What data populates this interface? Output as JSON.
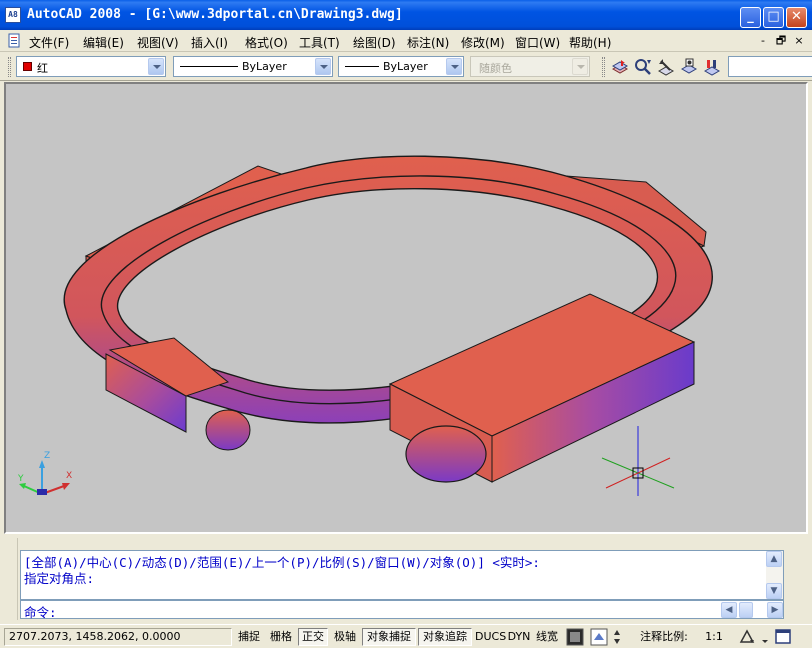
{
  "window": {
    "title": "AutoCAD 2008 - [G:\\www.3dportal.cn\\Drawing3.dwg]",
    "app_icon_text": "A8",
    "minimize": "_",
    "maximize": "□",
    "close": "✕"
  },
  "menu": {
    "items": [
      "文件(F)",
      "编辑(E)",
      "视图(V)",
      "插入(I)",
      "格式(O)",
      "工具(T)",
      "绘图(D)",
      "标注(N)",
      "修改(M)",
      "窗口(W)",
      "帮助(H)"
    ],
    "mdi": [
      "-",
      "🗗",
      "×"
    ]
  },
  "properties": {
    "color_value": "红",
    "color_swatch": "#E00000",
    "linetype_value": "ByLayer",
    "lineweight_value": "ByLayer",
    "plotstyle_value": "随颜色"
  },
  "toolbar_icons": [
    "make-object-layer-current-icon",
    "layer-previous-icon",
    "layer-states-icon",
    "layer-isolate-icon",
    "layer-freeze-icon"
  ],
  "viewport": {
    "background": "#C5C5C5",
    "object_color": "#E0604E",
    "shade_color": "#7A3AC8",
    "ucs_labels": {
      "z": "Z",
      "y": "Y",
      "x": "X"
    }
  },
  "command": {
    "history_1": "[全部(A)/中心(C)/动态(D)/范围(E)/上一个(P)/比例(S)/窗口(W)/对象(O)] <实时>:",
    "history_2": "指定对角点:",
    "prompt": "命令:"
  },
  "status": {
    "coords": "2707.2073, 1458.2062, 0.0000",
    "toggles": [
      {
        "label": "捕捉",
        "on": false
      },
      {
        "label": "栅格",
        "on": false
      },
      {
        "label": "正交",
        "on": true
      },
      {
        "label": "极轴",
        "on": false
      },
      {
        "label": "对象捕捉",
        "on": true
      },
      {
        "label": "对象追踪",
        "on": true
      },
      {
        "label": "DUCS",
        "on": false
      },
      {
        "label": "DYN",
        "on": false
      },
      {
        "label": "线宽",
        "on": false
      }
    ],
    "annotation_scale_label": "注释比例:",
    "annotation_scale_value": "1:1"
  }
}
